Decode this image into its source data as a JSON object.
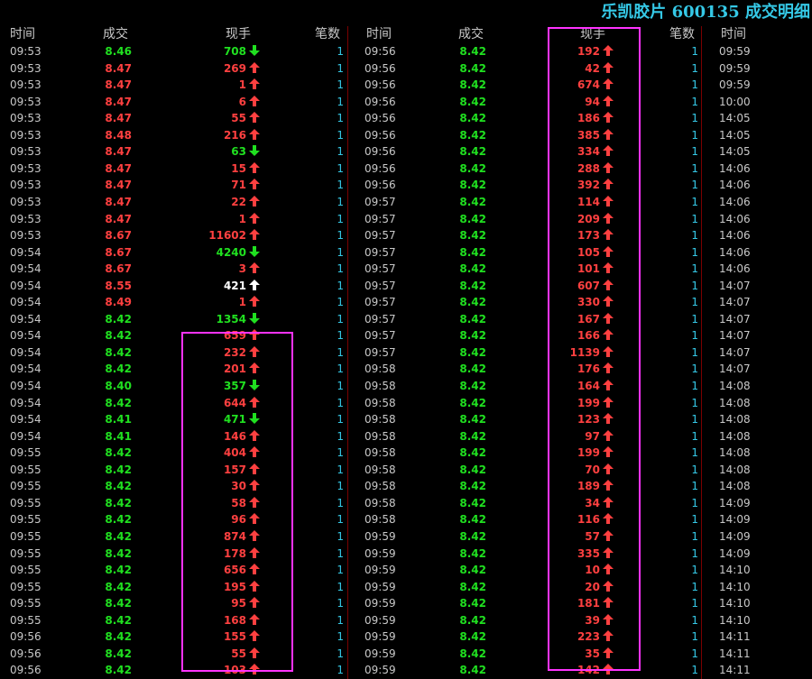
{
  "title": "乐凯胶片 600135 成交明细",
  "headers": [
    "时间",
    "成交",
    "现手",
    "笔数"
  ],
  "colors": {
    "up": "#ff4040",
    "down": "#20e020",
    "neutral": "#ffffff",
    "count": "#35c8e6",
    "title": "#35c8e6",
    "highlight": "#ff33ff"
  },
  "columns": [
    {
      "rows": [
        [
          "09:53",
          "8.46",
          "708",
          "down",
          "g",
          "g",
          "1"
        ],
        [
          "09:53",
          "8.47",
          "269",
          "up",
          "r",
          "r",
          "1"
        ],
        [
          "09:53",
          "8.47",
          "1",
          "up",
          "r",
          "r",
          "1"
        ],
        [
          "09:53",
          "8.47",
          "6",
          "up",
          "r",
          "r",
          "1"
        ],
        [
          "09:53",
          "8.47",
          "55",
          "up",
          "r",
          "r",
          "1"
        ],
        [
          "09:53",
          "8.48",
          "216",
          "up",
          "r",
          "r",
          "1"
        ],
        [
          "09:53",
          "8.47",
          "63",
          "down",
          "r",
          "g",
          "1"
        ],
        [
          "09:53",
          "8.47",
          "15",
          "up",
          "r",
          "r",
          "1"
        ],
        [
          "09:53",
          "8.47",
          "71",
          "up",
          "r",
          "r",
          "1"
        ],
        [
          "09:53",
          "8.47",
          "22",
          "up",
          "r",
          "r",
          "1"
        ],
        [
          "09:53",
          "8.47",
          "1",
          "up",
          "r",
          "r",
          "1"
        ],
        [
          "09:53",
          "8.67",
          "11602",
          "up",
          "r",
          "r",
          "1"
        ],
        [
          "09:54",
          "8.67",
          "4240",
          "down",
          "r",
          "g",
          "1"
        ],
        [
          "09:54",
          "8.67",
          "3",
          "up",
          "r",
          "r",
          "1"
        ],
        [
          "09:54",
          "8.55",
          "421",
          "up",
          "r",
          "w",
          "1"
        ],
        [
          "09:54",
          "8.49",
          "1",
          "up",
          "r",
          "r",
          "1"
        ],
        [
          "09:54",
          "8.42",
          "1354",
          "down",
          "g",
          "g",
          "1"
        ],
        [
          "09:54",
          "8.42",
          "659",
          "up",
          "g",
          "r",
          "1"
        ],
        [
          "09:54",
          "8.42",
          "232",
          "up",
          "g",
          "r",
          "1"
        ],
        [
          "09:54",
          "8.42",
          "201",
          "up",
          "g",
          "r",
          "1"
        ],
        [
          "09:54",
          "8.40",
          "357",
          "down",
          "g",
          "g",
          "1"
        ],
        [
          "09:54",
          "8.42",
          "644",
          "up",
          "g",
          "r",
          "1"
        ],
        [
          "09:54",
          "8.41",
          "471",
          "down",
          "g",
          "g",
          "1"
        ],
        [
          "09:54",
          "8.41",
          "146",
          "up",
          "g",
          "r",
          "1"
        ],
        [
          "09:55",
          "8.42",
          "404",
          "up",
          "g",
          "r",
          "1"
        ],
        [
          "09:55",
          "8.42",
          "157",
          "up",
          "g",
          "r",
          "1"
        ],
        [
          "09:55",
          "8.42",
          "30",
          "up",
          "g",
          "r",
          "1"
        ],
        [
          "09:55",
          "8.42",
          "58",
          "up",
          "g",
          "r",
          "1"
        ],
        [
          "09:55",
          "8.42",
          "96",
          "up",
          "g",
          "r",
          "1"
        ],
        [
          "09:55",
          "8.42",
          "874",
          "up",
          "g",
          "r",
          "1"
        ],
        [
          "09:55",
          "8.42",
          "178",
          "up",
          "g",
          "r",
          "1"
        ],
        [
          "09:55",
          "8.42",
          "656",
          "up",
          "g",
          "r",
          "1"
        ],
        [
          "09:55",
          "8.42",
          "195",
          "up",
          "g",
          "r",
          "1"
        ],
        [
          "09:55",
          "8.42",
          "95",
          "up",
          "g",
          "r",
          "1"
        ],
        [
          "09:55",
          "8.42",
          "168",
          "up",
          "g",
          "r",
          "1"
        ],
        [
          "09:56",
          "8.42",
          "155",
          "up",
          "g",
          "r",
          "1"
        ],
        [
          "09:56",
          "8.42",
          "55",
          "up",
          "g",
          "r",
          "1"
        ],
        [
          "09:56",
          "8.42",
          "103",
          "up",
          "g",
          "r",
          "1"
        ]
      ]
    },
    {
      "rows": [
        [
          "09:56",
          "8.42",
          "192",
          "up",
          "g",
          "r",
          "1"
        ],
        [
          "09:56",
          "8.42",
          "42",
          "up",
          "g",
          "r",
          "1"
        ],
        [
          "09:56",
          "8.42",
          "674",
          "up",
          "g",
          "r",
          "1"
        ],
        [
          "09:56",
          "8.42",
          "94",
          "up",
          "g",
          "r",
          "1"
        ],
        [
          "09:56",
          "8.42",
          "186",
          "up",
          "g",
          "r",
          "1"
        ],
        [
          "09:56",
          "8.42",
          "385",
          "up",
          "g",
          "r",
          "1"
        ],
        [
          "09:56",
          "8.42",
          "334",
          "up",
          "g",
          "r",
          "1"
        ],
        [
          "09:56",
          "8.42",
          "288",
          "up",
          "g",
          "r",
          "1"
        ],
        [
          "09:56",
          "8.42",
          "392",
          "up",
          "g",
          "r",
          "1"
        ],
        [
          "09:57",
          "8.42",
          "114",
          "up",
          "g",
          "r",
          "1"
        ],
        [
          "09:57",
          "8.42",
          "209",
          "up",
          "g",
          "r",
          "1"
        ],
        [
          "09:57",
          "8.42",
          "173",
          "up",
          "g",
          "r",
          "1"
        ],
        [
          "09:57",
          "8.42",
          "105",
          "up",
          "g",
          "r",
          "1"
        ],
        [
          "09:57",
          "8.42",
          "101",
          "up",
          "g",
          "r",
          "1"
        ],
        [
          "09:57",
          "8.42",
          "607",
          "up",
          "g",
          "r",
          "1"
        ],
        [
          "09:57",
          "8.42",
          "330",
          "up",
          "g",
          "r",
          "1"
        ],
        [
          "09:57",
          "8.42",
          "167",
          "up",
          "g",
          "r",
          "1"
        ],
        [
          "09:57",
          "8.42",
          "166",
          "up",
          "g",
          "r",
          "1"
        ],
        [
          "09:57",
          "8.42",
          "1139",
          "up",
          "g",
          "r",
          "1"
        ],
        [
          "09:58",
          "8.42",
          "176",
          "up",
          "g",
          "r",
          "1"
        ],
        [
          "09:58",
          "8.42",
          "164",
          "up",
          "g",
          "r",
          "1"
        ],
        [
          "09:58",
          "8.42",
          "199",
          "up",
          "g",
          "r",
          "1"
        ],
        [
          "09:58",
          "8.42",
          "123",
          "up",
          "g",
          "r",
          "1"
        ],
        [
          "09:58",
          "8.42",
          "97",
          "up",
          "g",
          "r",
          "1"
        ],
        [
          "09:58",
          "8.42",
          "199",
          "up",
          "g",
          "r",
          "1"
        ],
        [
          "09:58",
          "8.42",
          "70",
          "up",
          "g",
          "r",
          "1"
        ],
        [
          "09:58",
          "8.42",
          "189",
          "up",
          "g",
          "r",
          "1"
        ],
        [
          "09:58",
          "8.42",
          "34",
          "up",
          "g",
          "r",
          "1"
        ],
        [
          "09:58",
          "8.42",
          "116",
          "up",
          "g",
          "r",
          "1"
        ],
        [
          "09:59",
          "8.42",
          "57",
          "up",
          "g",
          "r",
          "1"
        ],
        [
          "09:59",
          "8.42",
          "335",
          "up",
          "g",
          "r",
          "1"
        ],
        [
          "09:59",
          "8.42",
          "10",
          "up",
          "g",
          "r",
          "1"
        ],
        [
          "09:59",
          "8.42",
          "20",
          "up",
          "g",
          "r",
          "1"
        ],
        [
          "09:59",
          "8.42",
          "181",
          "up",
          "g",
          "r",
          "1"
        ],
        [
          "09:59",
          "8.42",
          "39",
          "up",
          "g",
          "r",
          "1"
        ],
        [
          "09:59",
          "8.42",
          "223",
          "up",
          "g",
          "r",
          "1"
        ],
        [
          "09:59",
          "8.42",
          "35",
          "up",
          "g",
          "r",
          "1"
        ],
        [
          "09:59",
          "8.42",
          "142",
          "up",
          "g",
          "r",
          "1"
        ]
      ]
    },
    {
      "rows": [
        [
          "09:59"
        ],
        [
          "09:59"
        ],
        [
          "09:59"
        ],
        [
          "10:00"
        ],
        [
          "14:05"
        ],
        [
          "14:05"
        ],
        [
          "14:05"
        ],
        [
          "14:06"
        ],
        [
          "14:06"
        ],
        [
          "14:06"
        ],
        [
          "14:06"
        ],
        [
          "14:06"
        ],
        [
          "14:06"
        ],
        [
          "14:06"
        ],
        [
          "14:07"
        ],
        [
          "14:07"
        ],
        [
          "14:07"
        ],
        [
          "14:07"
        ],
        [
          "14:07"
        ],
        [
          "14:07"
        ],
        [
          "14:08"
        ],
        [
          "14:08"
        ],
        [
          "14:08"
        ],
        [
          "14:08"
        ],
        [
          "14:08"
        ],
        [
          "14:08"
        ],
        [
          "14:08"
        ],
        [
          "14:09"
        ],
        [
          "14:09"
        ],
        [
          "14:09"
        ],
        [
          "14:09"
        ],
        [
          "14:10"
        ],
        [
          "14:10"
        ],
        [
          "14:10"
        ],
        [
          "14:10"
        ],
        [
          "14:11"
        ],
        [
          "14:11"
        ],
        [
          "14:11"
        ]
      ]
    }
  ]
}
